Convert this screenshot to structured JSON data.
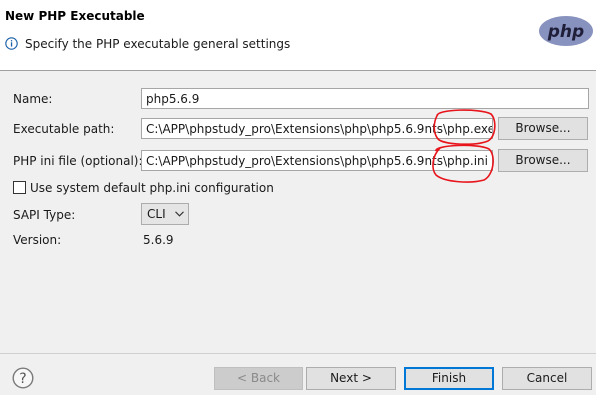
{
  "header": {
    "title": "New PHP Executable",
    "message": "Specify the PHP executable general settings",
    "info_icon": "info-icon",
    "logo_text": "php"
  },
  "form": {
    "name_label": "Name:",
    "name_value": "php5.6.9",
    "exe_label": "Executable path:",
    "exe_value": "C:\\APP\\phpstudy_pro\\Extensions\\php\\php5.6.9nts\\php.exe",
    "ini_label": "PHP ini file (optional):",
    "ini_value": "C:\\APP\\phpstudy_pro\\Extensions\\php\\php5.6.9nts\\php.ini",
    "browse_label": "Browse...",
    "checkbox_label": "Use system default php.ini configuration",
    "checkbox_checked": false,
    "sapi_label": "SAPI Type:",
    "sapi_value": "CLI",
    "version_label": "Version:",
    "version_value": "5.6.9"
  },
  "footer": {
    "back_label": "< Back",
    "next_label": "Next >",
    "finish_label": "Finish",
    "cancel_label": "Cancel",
    "help_icon": "help-icon"
  },
  "colors": {
    "annotation": "#e8141b",
    "logo_fill": "#8892be",
    "default_button_border": "#0078d7",
    "info_icon": "#1a5fa8"
  }
}
